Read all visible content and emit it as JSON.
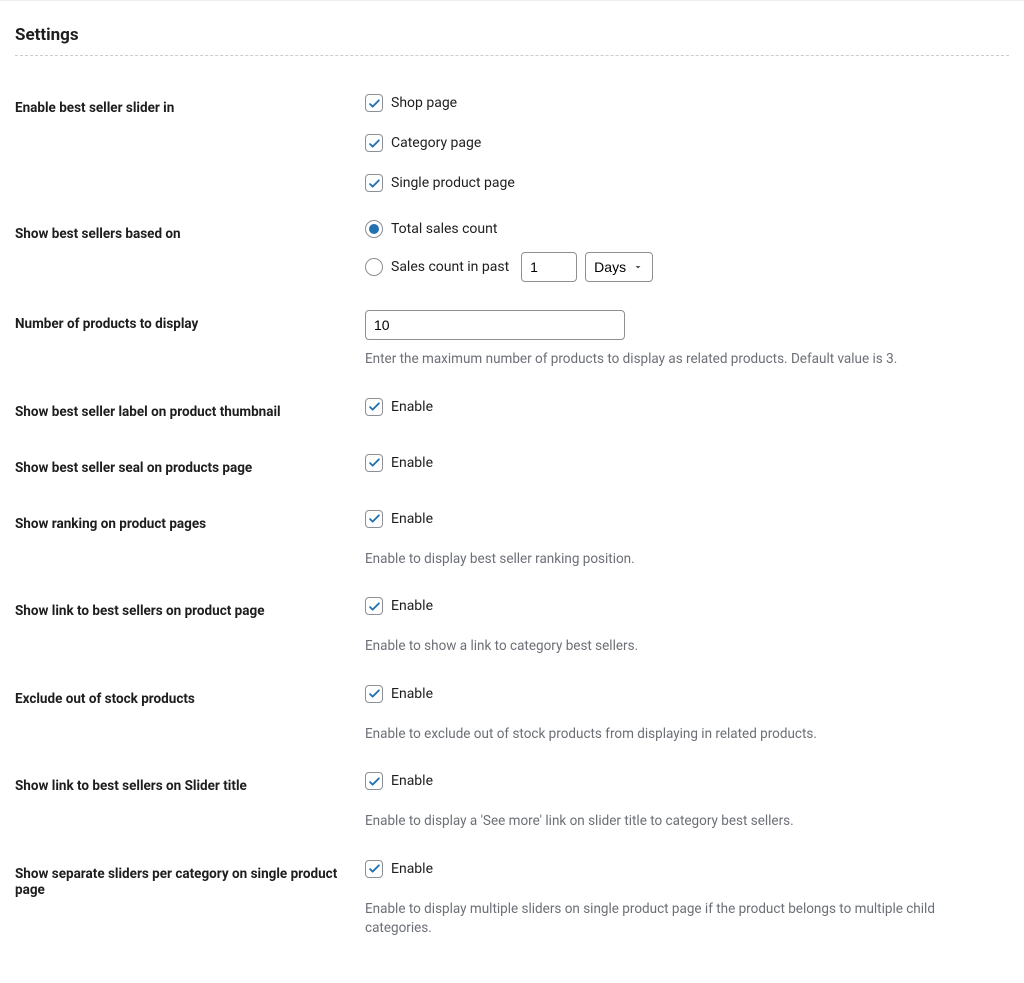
{
  "title": "Settings",
  "rows": {
    "enable_slider": {
      "label": "Enable best seller slider in",
      "options": [
        {
          "label": "Shop page",
          "checked": true
        },
        {
          "label": "Category page",
          "checked": true
        },
        {
          "label": "Single product page",
          "checked": true
        }
      ]
    },
    "based_on": {
      "label": "Show best sellers based on",
      "radios": [
        {
          "label": "Total sales count",
          "checked": true
        },
        {
          "label": "Sales count in past",
          "checked": false
        }
      ],
      "past_count": "1",
      "unit": "Days"
    },
    "num_products": {
      "label": "Number of products to display",
      "value": "10",
      "help": "Enter the maximum number of products to display as related products. Default value is 3."
    },
    "label_thumb": {
      "label": "Show best seller label on product thumbnail",
      "enable": "Enable"
    },
    "seal_page": {
      "label": "Show best seller seal on products page",
      "enable": "Enable"
    },
    "ranking": {
      "label": "Show ranking on product pages",
      "enable": "Enable",
      "help": "Enable to display best seller ranking position."
    },
    "link_product": {
      "label": "Show link to best sellers on product page",
      "enable": "Enable",
      "help": "Enable to show a link to category best sellers."
    },
    "exclude_oos": {
      "label": "Exclude out of stock products",
      "enable": "Enable",
      "help": "Enable to exclude out of stock products from displaying in related products."
    },
    "link_slider_title": {
      "label": "Show link to best sellers on Slider title",
      "enable": "Enable",
      "help": "Enable to display a 'See more' link on slider title to category best sellers."
    },
    "separate_sliders": {
      "label": "Show separate sliders per category on single product page",
      "enable": "Enable",
      "help": "Enable to display multiple sliders on single product page if the product belongs to multiple child categories."
    }
  }
}
